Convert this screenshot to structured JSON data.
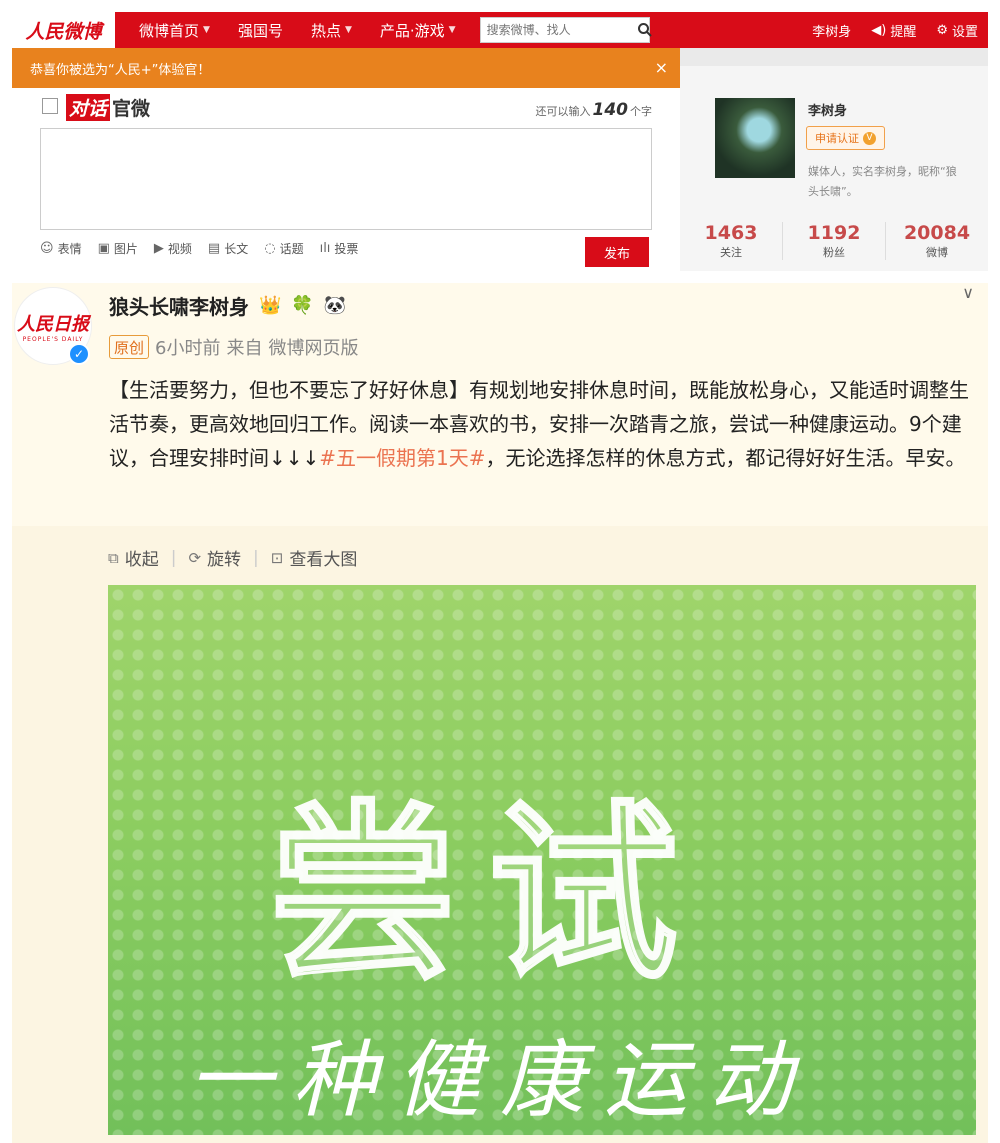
{
  "nav": {
    "logo": "人民微博",
    "items": [
      {
        "label": "微博首页",
        "caret": true
      },
      {
        "label": "强国号",
        "caret": false
      },
      {
        "label": "热点",
        "caret": true
      },
      {
        "label": "产品·游戏",
        "caret": true
      }
    ],
    "search_placeholder": "搜索微博、找人",
    "user": "李树身",
    "notify": "提醒",
    "settings": "设置"
  },
  "notice": {
    "text": "恭喜你被选为“人民+”体验官！",
    "close": "×"
  },
  "composer": {
    "title_box": "对话",
    "title_rest": "官微",
    "remain_prefix": "还可以输入",
    "remain_count": "140",
    "remain_suffix": "个字",
    "tools": [
      "表情",
      "图片",
      "视频",
      "长文",
      "话题",
      "投票"
    ],
    "publish": "发布"
  },
  "profile": {
    "name": "李树身",
    "verify": "申请认证",
    "bio": "媒体人，实名李树身，昵称“狼头长啸”。",
    "stats": [
      {
        "num": "1463",
        "label": "关注"
      },
      {
        "num": "1192",
        "label": "粉丝"
      },
      {
        "num": "20084",
        "label": "微博"
      }
    ]
  },
  "post": {
    "avatar_cn": "人民日报",
    "avatar_en": "PEOPLE'S DAILY",
    "username": "狼头长啸李树身",
    "tag": "原创",
    "time": "6小时前",
    "source_prefix": "来自",
    "source": "微博网页版",
    "text_before": "【生活要努力，但也不要忘了好好休息】有规划地安排休息时间，既能放松身心，又能适时调整生活节奏，更高效地回归工作。阅读一本喜欢的书，安排一次踏青之旅，尝试一种健康运动。9个建议，合理安排时间↓↓↓",
    "topic": "#五一假期第1天#",
    "text_after": "，无论选择怎样的休息方式，都记得好好生活。早安。",
    "actions": [
      "收起",
      "旋转",
      "查看大图"
    ],
    "poster_title": "尝试",
    "poster_subtitle": "一种健康运动"
  },
  "colors": {
    "brand_red": "#d80c18",
    "notice_orange": "#e8821e",
    "topic_orange": "#eb7350",
    "stat_red": "#c74a4a",
    "poster_green": "#8ccd60"
  }
}
